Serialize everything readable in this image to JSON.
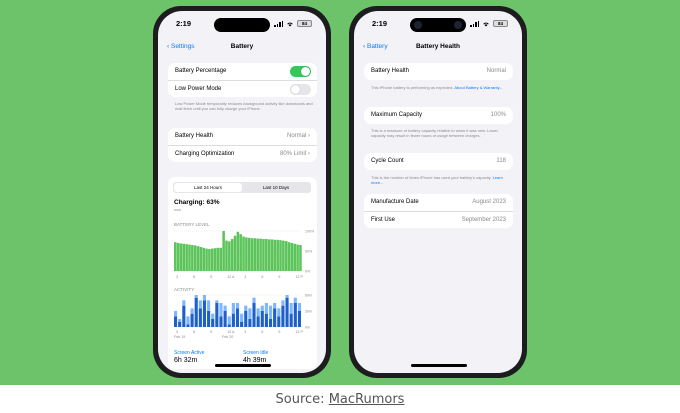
{
  "caption": {
    "prefix": "Source: ",
    "link": "MacRumors"
  },
  "colors": {
    "background": "#6cc36a",
    "accent": "#0a7aff",
    "toggle_on": "#34c759",
    "bar_green": "#5cc45a",
    "activity_dark": "#1e5fc9",
    "activity_light": "#7db7ff"
  },
  "left_phone": {
    "status": {
      "time": "2:19",
      "battery": "84"
    },
    "nav": {
      "back": "Settings",
      "title": "Battery"
    },
    "toggles": [
      {
        "label": "Battery Percentage",
        "on": true
      },
      {
        "label": "Low Power Mode",
        "on": false
      }
    ],
    "low_power_note": "Low Power Mode temporarily reduces background activity like downloads and mail fetch until you can fully charge your iPhone.",
    "rows": [
      {
        "label": "Battery Health",
        "value": "Normal"
      },
      {
        "label": "Charging Optimization",
        "value": "80% Limit"
      }
    ],
    "segmented": {
      "options": [
        "Last 24 Hours",
        "Last 10 Days"
      ],
      "selected": 0
    },
    "charging": {
      "title": "Charging: 63%",
      "sub": "now"
    },
    "battery_level": {
      "label": "BATTERY LEVEL",
      "y_ticks": [
        "100%",
        "50%",
        "0%"
      ],
      "x_ticks": [
        "3",
        "6",
        "9",
        "12 A",
        "3",
        "6",
        "9",
        "12 P"
      ],
      "levels": [
        72,
        70,
        69,
        68,
        67,
        66,
        65,
        64,
        62,
        60,
        58,
        56,
        55,
        56,
        57,
        58,
        58,
        100,
        76,
        74,
        80,
        88,
        98,
        92,
        86,
        84,
        83,
        82,
        82,
        81,
        81,
        80,
        80,
        79,
        79,
        78,
        78,
        77,
        76,
        75,
        72,
        70,
        68,
        66,
        65
      ]
    },
    "activity": {
      "label": "ACTIVITY",
      "y_ticks": [
        "60m",
        "30m",
        "0m"
      ],
      "x_ticks": [
        "3",
        "6",
        "9",
        "12 A",
        "3",
        "6",
        "9",
        "12 P"
      ],
      "dates": [
        "Feb 19",
        "Feb 20"
      ],
      "screen_on": [
        20,
        10,
        40,
        5,
        25,
        55,
        35,
        50,
        30,
        15,
        45,
        20,
        30,
        5,
        25,
        35,
        10,
        30,
        15,
        45,
        20,
        30,
        25,
        15,
        35,
        20,
        40,
        55,
        25,
        45,
        30
      ],
      "screen_off": [
        10,
        5,
        10,
        15,
        10,
        5,
        15,
        10,
        20,
        10,
        5,
        25,
        10,
        15,
        20,
        10,
        15,
        10,
        20,
        10,
        15,
        10,
        20,
        25,
        10,
        15,
        10,
        5,
        20,
        10,
        15
      ]
    },
    "stats": [
      {
        "label": "Screen Active",
        "value": "6h 32m"
      },
      {
        "label": "Screen Idle",
        "value": "4h 39m"
      }
    ]
  },
  "right_phone": {
    "status": {
      "time": "2:19",
      "battery": "84"
    },
    "nav": {
      "back": "Battery",
      "title": "Battery Health"
    },
    "health": {
      "label": "Battery Health",
      "value": "Normal"
    },
    "health_note": "This iPhone battery is performing as expected.",
    "health_note_link": "About Battery & Warranty...",
    "capacity": {
      "label": "Maximum Capacity",
      "value": "100%"
    },
    "capacity_note": "This is a measure of battery capacity relative to when it was new. Lower capacity may result in fewer hours of usage between charges.",
    "cycle": {
      "label": "Cycle Count",
      "value": "118"
    },
    "cycle_note": "This is the number of times iPhone has used your battery's capacity.",
    "cycle_note_link": "Learn more...",
    "manufacture": {
      "label": "Manufacture Date",
      "value": "August 2023"
    },
    "first_use": {
      "label": "First Use",
      "value": "September 2023"
    }
  }
}
